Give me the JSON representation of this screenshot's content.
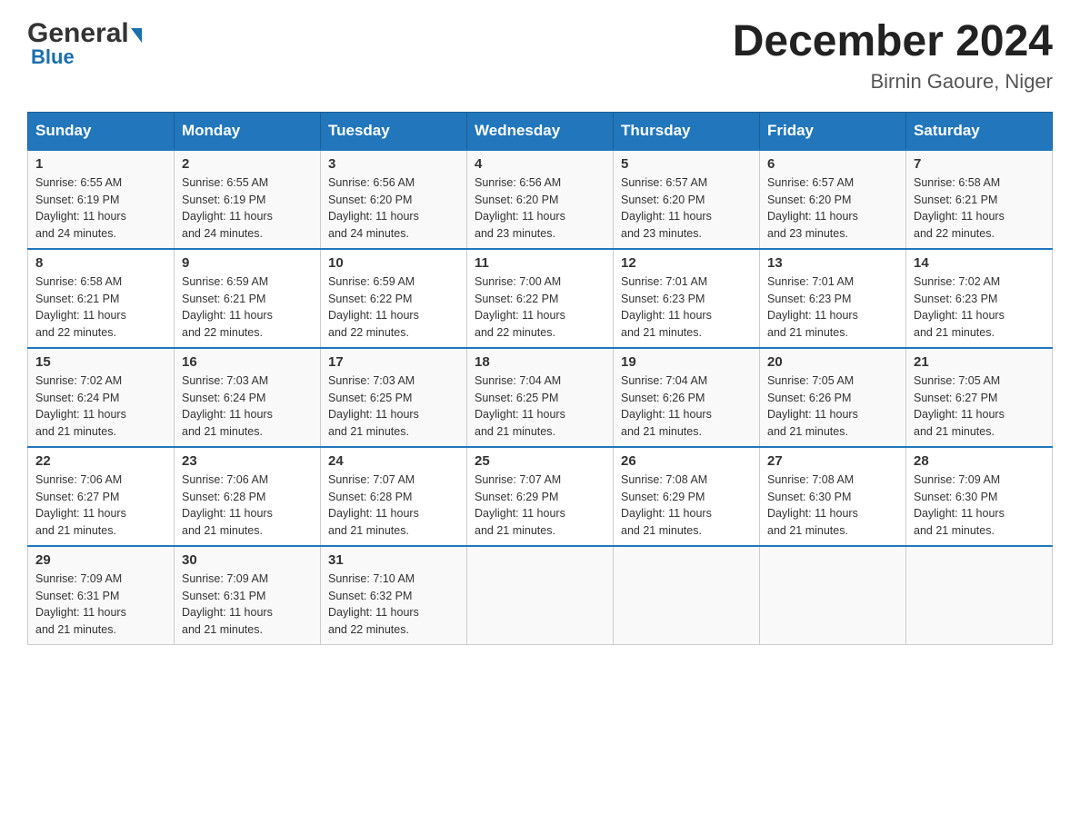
{
  "header": {
    "logo_general": "General",
    "logo_blue": "Blue",
    "main_title": "December 2024",
    "subtitle": "Birnin Gaoure, Niger"
  },
  "days_of_week": [
    "Sunday",
    "Monday",
    "Tuesday",
    "Wednesday",
    "Thursday",
    "Friday",
    "Saturday"
  ],
  "weeks": [
    [
      {
        "day": "1",
        "sunrise": "6:55 AM",
        "sunset": "6:19 PM",
        "daylight": "11 hours and 24 minutes."
      },
      {
        "day": "2",
        "sunrise": "6:55 AM",
        "sunset": "6:19 PM",
        "daylight": "11 hours and 24 minutes."
      },
      {
        "day": "3",
        "sunrise": "6:56 AM",
        "sunset": "6:20 PM",
        "daylight": "11 hours and 24 minutes."
      },
      {
        "day": "4",
        "sunrise": "6:56 AM",
        "sunset": "6:20 PM",
        "daylight": "11 hours and 23 minutes."
      },
      {
        "day": "5",
        "sunrise": "6:57 AM",
        "sunset": "6:20 PM",
        "daylight": "11 hours and 23 minutes."
      },
      {
        "day": "6",
        "sunrise": "6:57 AM",
        "sunset": "6:20 PM",
        "daylight": "11 hours and 23 minutes."
      },
      {
        "day": "7",
        "sunrise": "6:58 AM",
        "sunset": "6:21 PM",
        "daylight": "11 hours and 22 minutes."
      }
    ],
    [
      {
        "day": "8",
        "sunrise": "6:58 AM",
        "sunset": "6:21 PM",
        "daylight": "11 hours and 22 minutes."
      },
      {
        "day": "9",
        "sunrise": "6:59 AM",
        "sunset": "6:21 PM",
        "daylight": "11 hours and 22 minutes."
      },
      {
        "day": "10",
        "sunrise": "6:59 AM",
        "sunset": "6:22 PM",
        "daylight": "11 hours and 22 minutes."
      },
      {
        "day": "11",
        "sunrise": "7:00 AM",
        "sunset": "6:22 PM",
        "daylight": "11 hours and 22 minutes."
      },
      {
        "day": "12",
        "sunrise": "7:01 AM",
        "sunset": "6:23 PM",
        "daylight": "11 hours and 21 minutes."
      },
      {
        "day": "13",
        "sunrise": "7:01 AM",
        "sunset": "6:23 PM",
        "daylight": "11 hours and 21 minutes."
      },
      {
        "day": "14",
        "sunrise": "7:02 AM",
        "sunset": "6:23 PM",
        "daylight": "11 hours and 21 minutes."
      }
    ],
    [
      {
        "day": "15",
        "sunrise": "7:02 AM",
        "sunset": "6:24 PM",
        "daylight": "11 hours and 21 minutes."
      },
      {
        "day": "16",
        "sunrise": "7:03 AM",
        "sunset": "6:24 PM",
        "daylight": "11 hours and 21 minutes."
      },
      {
        "day": "17",
        "sunrise": "7:03 AM",
        "sunset": "6:25 PM",
        "daylight": "11 hours and 21 minutes."
      },
      {
        "day": "18",
        "sunrise": "7:04 AM",
        "sunset": "6:25 PM",
        "daylight": "11 hours and 21 minutes."
      },
      {
        "day": "19",
        "sunrise": "7:04 AM",
        "sunset": "6:26 PM",
        "daylight": "11 hours and 21 minutes."
      },
      {
        "day": "20",
        "sunrise": "7:05 AM",
        "sunset": "6:26 PM",
        "daylight": "11 hours and 21 minutes."
      },
      {
        "day": "21",
        "sunrise": "7:05 AM",
        "sunset": "6:27 PM",
        "daylight": "11 hours and 21 minutes."
      }
    ],
    [
      {
        "day": "22",
        "sunrise": "7:06 AM",
        "sunset": "6:27 PM",
        "daylight": "11 hours and 21 minutes."
      },
      {
        "day": "23",
        "sunrise": "7:06 AM",
        "sunset": "6:28 PM",
        "daylight": "11 hours and 21 minutes."
      },
      {
        "day": "24",
        "sunrise": "7:07 AM",
        "sunset": "6:28 PM",
        "daylight": "11 hours and 21 minutes."
      },
      {
        "day": "25",
        "sunrise": "7:07 AM",
        "sunset": "6:29 PM",
        "daylight": "11 hours and 21 minutes."
      },
      {
        "day": "26",
        "sunrise": "7:08 AM",
        "sunset": "6:29 PM",
        "daylight": "11 hours and 21 minutes."
      },
      {
        "day": "27",
        "sunrise": "7:08 AM",
        "sunset": "6:30 PM",
        "daylight": "11 hours and 21 minutes."
      },
      {
        "day": "28",
        "sunrise": "7:09 AM",
        "sunset": "6:30 PM",
        "daylight": "11 hours and 21 minutes."
      }
    ],
    [
      {
        "day": "29",
        "sunrise": "7:09 AM",
        "sunset": "6:31 PM",
        "daylight": "11 hours and 21 minutes."
      },
      {
        "day": "30",
        "sunrise": "7:09 AM",
        "sunset": "6:31 PM",
        "daylight": "11 hours and 21 minutes."
      },
      {
        "day": "31",
        "sunrise": "7:10 AM",
        "sunset": "6:32 PM",
        "daylight": "11 hours and 22 minutes."
      },
      null,
      null,
      null,
      null
    ]
  ],
  "labels": {
    "sunrise": "Sunrise:",
    "sunset": "Sunset:",
    "daylight": "Daylight:"
  }
}
